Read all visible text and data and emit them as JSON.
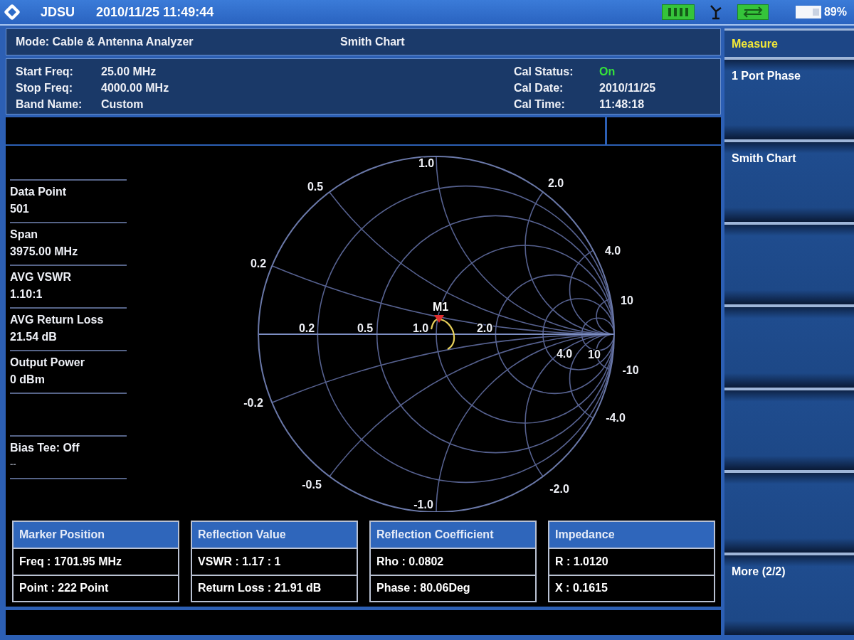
{
  "top_bar": {
    "brand": "JDSU",
    "datetime": "2010/11/25 11:49:44",
    "battery": "89%"
  },
  "mode_bar": {
    "mode": "Mode: Cable & Antenna Analyzer",
    "view": "Smith Chart"
  },
  "settings": [
    {
      "label": "Start Freq:",
      "value": "25.00 MHz"
    },
    {
      "label": "Stop Freq:",
      "value": "4000.00 MHz"
    },
    {
      "label": "Band Name:",
      "value": "Custom"
    }
  ],
  "calibration": {
    "status": {
      "label": "Cal Status:",
      "value": "On",
      "on": true
    },
    "details": [
      {
        "label": "Cal Date:",
        "value": "2010/11/25"
      },
      {
        "label": "Cal Time:",
        "value": "11:48:18"
      }
    ]
  },
  "measurements": [
    {
      "label": "Data Point",
      "value": "501"
    },
    {
      "label": "Span",
      "value": "3975.00 MHz"
    },
    {
      "label": "AVG VSWR",
      "value": "1.10:1"
    },
    {
      "label": "AVG Return Loss",
      "value": "21.54 dB"
    },
    {
      "label": "Output Power",
      "value": "0 dBm"
    }
  ],
  "bias_tee": {
    "label": "Bias Tee: Off",
    "value": "--"
  },
  "smith_chart": {
    "grid_labels": [
      "1.0",
      "0.5",
      "2.0",
      "0.2",
      "4.0",
      "10",
      "0.2",
      "0.5",
      "1.0",
      "2.0",
      "4.0",
      "10",
      "-10",
      "-0.2",
      "-4.0",
      "-0.5",
      "-2.0",
      "-1.0"
    ],
    "marker": "M1"
  },
  "marker_tables": [
    {
      "title": "Marker Position",
      "rows": [
        "Freq : 1701.95 MHz",
        "Point : 222 Point"
      ]
    },
    {
      "title": "Reflection Value",
      "rows": [
        "VSWR : 1.17 : 1",
        "Return Loss : 21.91 dB"
      ]
    },
    {
      "title": "Reflection Coefficient",
      "rows": [
        "Rho : 0.0802",
        "Phase : 80.06Deg"
      ]
    },
    {
      "title": "Impedance",
      "rows": [
        "R : 1.0120",
        "X : 0.1615"
      ]
    }
  ],
  "menu": {
    "title": "Measure",
    "keys": [
      {
        "label": "1 Port Phase"
      },
      {
        "label": "Smith Chart"
      }
    ],
    "more": {
      "label": "More (2/2)"
    }
  }
}
